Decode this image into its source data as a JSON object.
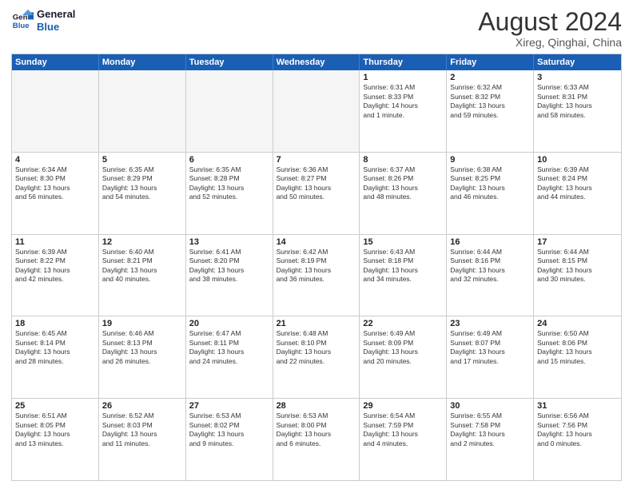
{
  "logo": {
    "line1": "General",
    "line2": "Blue"
  },
  "title": "August 2024",
  "location": "Xireg, Qinghai, China",
  "days_header": [
    "Sunday",
    "Monday",
    "Tuesday",
    "Wednesday",
    "Thursday",
    "Friday",
    "Saturday"
  ],
  "weeks": [
    [
      {
        "day": "",
        "detail": ""
      },
      {
        "day": "",
        "detail": ""
      },
      {
        "day": "",
        "detail": ""
      },
      {
        "day": "",
        "detail": ""
      },
      {
        "day": "1",
        "detail": "Sunrise: 6:31 AM\nSunset: 8:33 PM\nDaylight: 14 hours\nand 1 minute."
      },
      {
        "day": "2",
        "detail": "Sunrise: 6:32 AM\nSunset: 8:32 PM\nDaylight: 13 hours\nand 59 minutes."
      },
      {
        "day": "3",
        "detail": "Sunrise: 6:33 AM\nSunset: 8:31 PM\nDaylight: 13 hours\nand 58 minutes."
      }
    ],
    [
      {
        "day": "4",
        "detail": "Sunrise: 6:34 AM\nSunset: 8:30 PM\nDaylight: 13 hours\nand 56 minutes."
      },
      {
        "day": "5",
        "detail": "Sunrise: 6:35 AM\nSunset: 8:29 PM\nDaylight: 13 hours\nand 54 minutes."
      },
      {
        "day": "6",
        "detail": "Sunrise: 6:35 AM\nSunset: 8:28 PM\nDaylight: 13 hours\nand 52 minutes."
      },
      {
        "day": "7",
        "detail": "Sunrise: 6:36 AM\nSunset: 8:27 PM\nDaylight: 13 hours\nand 50 minutes."
      },
      {
        "day": "8",
        "detail": "Sunrise: 6:37 AM\nSunset: 8:26 PM\nDaylight: 13 hours\nand 48 minutes."
      },
      {
        "day": "9",
        "detail": "Sunrise: 6:38 AM\nSunset: 8:25 PM\nDaylight: 13 hours\nand 46 minutes."
      },
      {
        "day": "10",
        "detail": "Sunrise: 6:39 AM\nSunset: 8:24 PM\nDaylight: 13 hours\nand 44 minutes."
      }
    ],
    [
      {
        "day": "11",
        "detail": "Sunrise: 6:39 AM\nSunset: 8:22 PM\nDaylight: 13 hours\nand 42 minutes."
      },
      {
        "day": "12",
        "detail": "Sunrise: 6:40 AM\nSunset: 8:21 PM\nDaylight: 13 hours\nand 40 minutes."
      },
      {
        "day": "13",
        "detail": "Sunrise: 6:41 AM\nSunset: 8:20 PM\nDaylight: 13 hours\nand 38 minutes."
      },
      {
        "day": "14",
        "detail": "Sunrise: 6:42 AM\nSunset: 8:19 PM\nDaylight: 13 hours\nand 36 minutes."
      },
      {
        "day": "15",
        "detail": "Sunrise: 6:43 AM\nSunset: 8:18 PM\nDaylight: 13 hours\nand 34 minutes."
      },
      {
        "day": "16",
        "detail": "Sunrise: 6:44 AM\nSunset: 8:16 PM\nDaylight: 13 hours\nand 32 minutes."
      },
      {
        "day": "17",
        "detail": "Sunrise: 6:44 AM\nSunset: 8:15 PM\nDaylight: 13 hours\nand 30 minutes."
      }
    ],
    [
      {
        "day": "18",
        "detail": "Sunrise: 6:45 AM\nSunset: 8:14 PM\nDaylight: 13 hours\nand 28 minutes."
      },
      {
        "day": "19",
        "detail": "Sunrise: 6:46 AM\nSunset: 8:13 PM\nDaylight: 13 hours\nand 26 minutes."
      },
      {
        "day": "20",
        "detail": "Sunrise: 6:47 AM\nSunset: 8:11 PM\nDaylight: 13 hours\nand 24 minutes."
      },
      {
        "day": "21",
        "detail": "Sunrise: 6:48 AM\nSunset: 8:10 PM\nDaylight: 13 hours\nand 22 minutes."
      },
      {
        "day": "22",
        "detail": "Sunrise: 6:49 AM\nSunset: 8:09 PM\nDaylight: 13 hours\nand 20 minutes."
      },
      {
        "day": "23",
        "detail": "Sunrise: 6:49 AM\nSunset: 8:07 PM\nDaylight: 13 hours\nand 17 minutes."
      },
      {
        "day": "24",
        "detail": "Sunrise: 6:50 AM\nSunset: 8:06 PM\nDaylight: 13 hours\nand 15 minutes."
      }
    ],
    [
      {
        "day": "25",
        "detail": "Sunrise: 6:51 AM\nSunset: 8:05 PM\nDaylight: 13 hours\nand 13 minutes."
      },
      {
        "day": "26",
        "detail": "Sunrise: 6:52 AM\nSunset: 8:03 PM\nDaylight: 13 hours\nand 11 minutes."
      },
      {
        "day": "27",
        "detail": "Sunrise: 6:53 AM\nSunset: 8:02 PM\nDaylight: 13 hours\nand 9 minutes."
      },
      {
        "day": "28",
        "detail": "Sunrise: 6:53 AM\nSunset: 8:00 PM\nDaylight: 13 hours\nand 6 minutes."
      },
      {
        "day": "29",
        "detail": "Sunrise: 6:54 AM\nSunset: 7:59 PM\nDaylight: 13 hours\nand 4 minutes."
      },
      {
        "day": "30",
        "detail": "Sunrise: 6:55 AM\nSunset: 7:58 PM\nDaylight: 13 hours\nand 2 minutes."
      },
      {
        "day": "31",
        "detail": "Sunrise: 6:56 AM\nSunset: 7:56 PM\nDaylight: 13 hours\nand 0 minutes."
      }
    ]
  ]
}
